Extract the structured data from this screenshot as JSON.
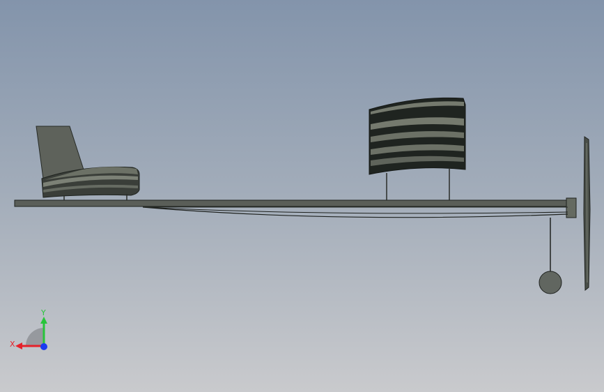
{
  "viewport": {
    "background_top": "#8394ab",
    "background_bottom": "#c9cacd",
    "model_body_color": "#4a4f49",
    "model_dark_color": "#1f2420",
    "model_light_color": "#7d8276"
  },
  "triad": {
    "x_label": "X",
    "y_label": "Y",
    "x_color": "#e5212a",
    "y_color": "#27c53a",
    "z_color": "#1a3cf0"
  },
  "model_parts": [
    {
      "name": "seat",
      "icon": "chair-part"
    },
    {
      "name": "front-wing",
      "icon": "multi-slat-wing"
    },
    {
      "name": "fuselage-boom",
      "icon": "boom"
    },
    {
      "name": "propeller",
      "icon": "propeller-blade"
    },
    {
      "name": "pendulum-weight",
      "icon": "ball-weight"
    }
  ]
}
